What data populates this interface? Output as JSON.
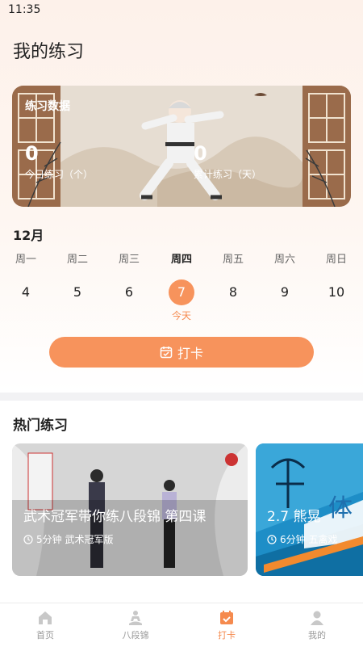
{
  "status_bar": {
    "time": "11:35"
  },
  "page_title": "我的练习",
  "stats": {
    "title": "练习数据",
    "today_count": "0",
    "today_label": "今日练习（个）",
    "total_days": "0",
    "total_label": "累计练习（天）"
  },
  "calendar": {
    "month": "12月",
    "days": [
      {
        "weekday": "周一",
        "date": "4"
      },
      {
        "weekday": "周二",
        "date": "5"
      },
      {
        "weekday": "周三",
        "date": "6"
      },
      {
        "weekday": "周四",
        "date": "7"
      },
      {
        "weekday": "周五",
        "date": "8"
      },
      {
        "weekday": "周六",
        "date": "9"
      },
      {
        "weekday": "周日",
        "date": "10"
      }
    ],
    "today_label": "今天"
  },
  "checkin_label": "打卡",
  "hot": {
    "title": "热门练习",
    "cards": [
      {
        "title": "武术冠军带你练八段锦 第四课",
        "meta": "5分钟 武术冠军版"
      },
      {
        "title": "2.7 熊晃",
        "meta": "6分钟 五禽戏",
        "poster_text": "体"
      }
    ]
  },
  "tabs": [
    {
      "label": "首页",
      "icon": "home-icon"
    },
    {
      "label": "八段锦",
      "icon": "meditation-icon"
    },
    {
      "label": "打卡",
      "icon": "calendar-check-icon",
      "active": true
    },
    {
      "label": "我的",
      "icon": "user-icon"
    }
  ],
  "colors": {
    "accent": "#f7935c",
    "accent_text": "#f58a4e"
  }
}
